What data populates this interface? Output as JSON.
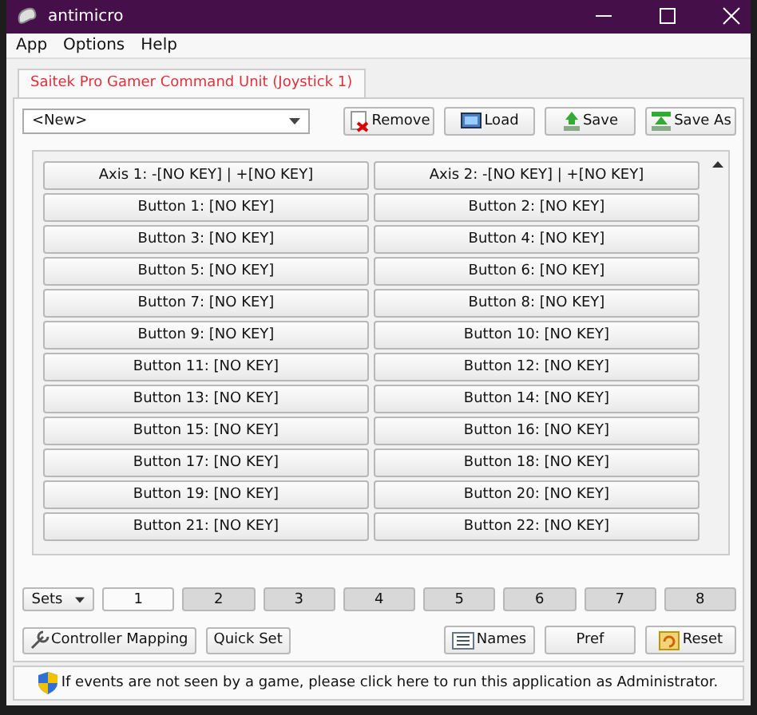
{
  "window": {
    "title": "antimicro"
  },
  "menu": [
    "App",
    "Options",
    "Help"
  ],
  "tabs": [
    {
      "label": "Saitek Pro Gamer Command Unit (Joystick 1)",
      "selected": true
    }
  ],
  "profile": {
    "value": "<New>"
  },
  "profile_buttons": [
    {
      "kind": "remove",
      "label": "Remove"
    },
    {
      "kind": "load",
      "label": "Load"
    },
    {
      "kind": "save",
      "label": "Save"
    },
    {
      "kind": "saveas",
      "label": "Save As"
    }
  ],
  "mappings": [
    "Axis 1: -[NO KEY] | +[NO KEY]",
    "Axis 2: -[NO KEY] | +[NO KEY]",
    "Button 1: [NO KEY]",
    "Button 2: [NO KEY]",
    "Button 3: [NO KEY]",
    "Button 4: [NO KEY]",
    "Button 5: [NO KEY]",
    "Button 6: [NO KEY]",
    "Button 7: [NO KEY]",
    "Button 8: [NO KEY]",
    "Button 9: [NO KEY]",
    "Button 10: [NO KEY]",
    "Button 11: [NO KEY]",
    "Button 12: [NO KEY]",
    "Button 13: [NO KEY]",
    "Button 14: [NO KEY]",
    "Button 15: [NO KEY]",
    "Button 16: [NO KEY]",
    "Button 17: [NO KEY]",
    "Button 18: [NO KEY]",
    "Button 19: [NO KEY]",
    "Button 20: [NO KEY]",
    "Button 21: [NO KEY]",
    "Button 22: [NO KEY]"
  ],
  "sets": {
    "label": "Sets",
    "items": [
      {
        "label": "1",
        "selected": true
      },
      {
        "label": "2",
        "selected": false
      },
      {
        "label": "3",
        "selected": false
      },
      {
        "label": "4",
        "selected": false
      },
      {
        "label": "5",
        "selected": false
      },
      {
        "label": "6",
        "selected": false
      },
      {
        "label": "7",
        "selected": false
      },
      {
        "label": "8",
        "selected": false
      }
    ]
  },
  "bottom_left": [
    {
      "kind": "mapping",
      "label": "Controller Mapping"
    },
    {
      "kind": "plain",
      "label": "Quick Set"
    }
  ],
  "bottom_right": [
    {
      "kind": "names",
      "label": "Names"
    },
    {
      "kind": "plain",
      "label": "Pref"
    },
    {
      "kind": "reset",
      "label": "Reset"
    }
  ],
  "status_bar": "If events are not seen by a game, please click here to run this application as Administrator."
}
